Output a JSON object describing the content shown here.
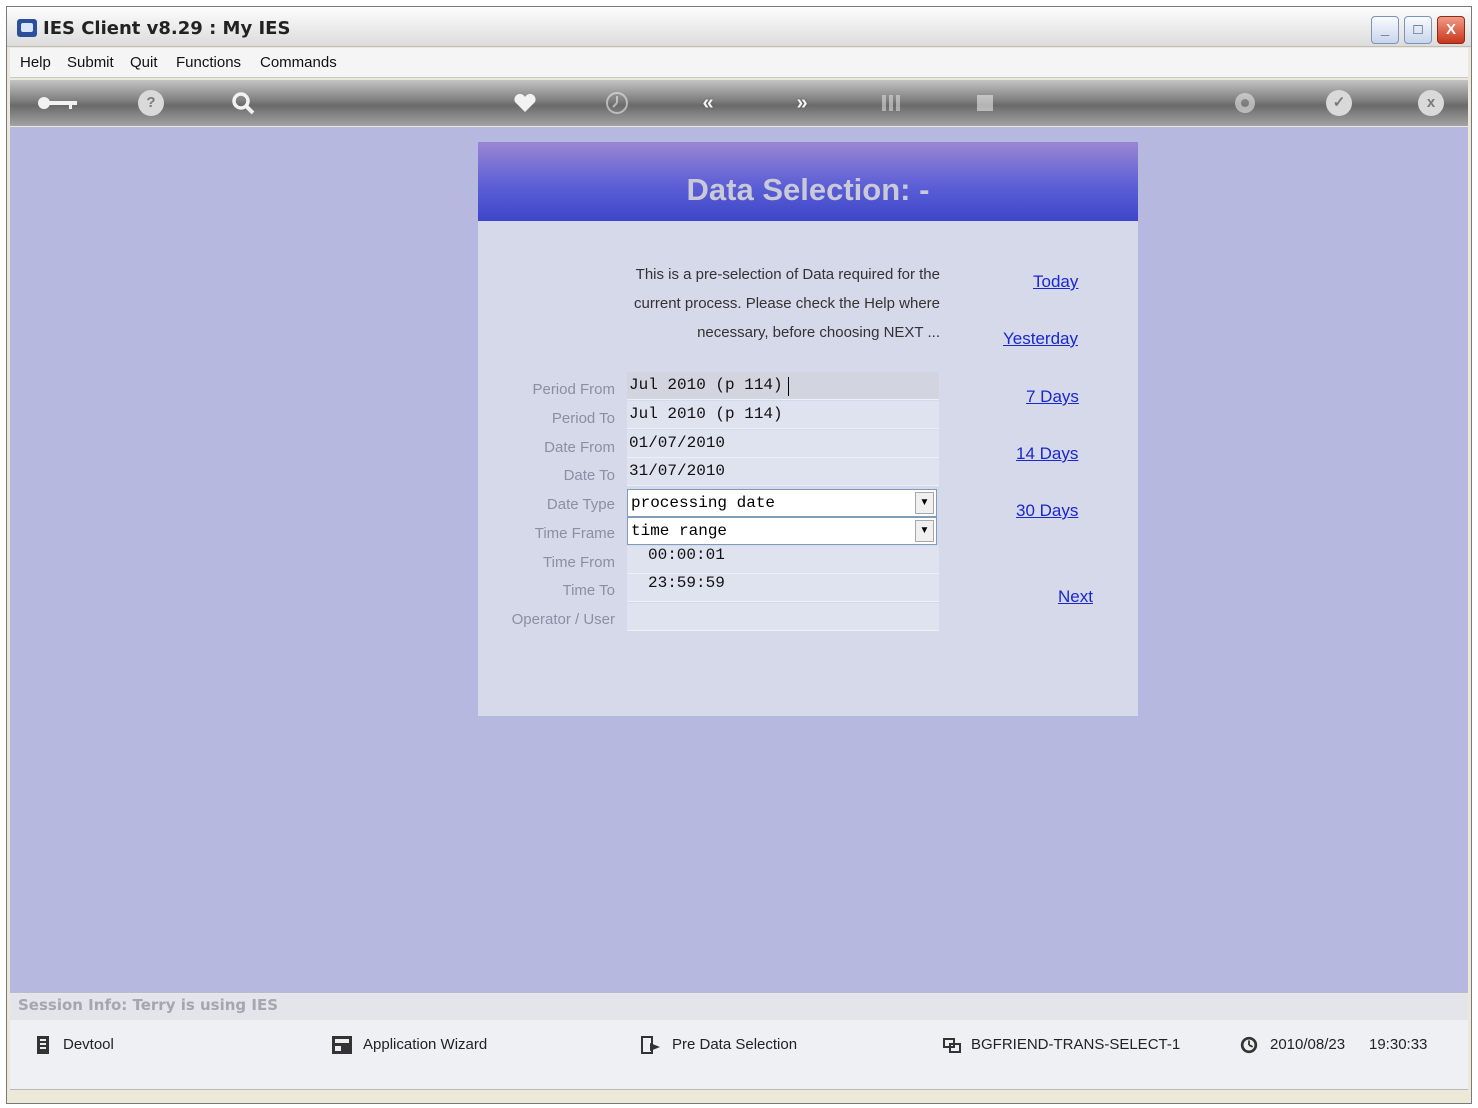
{
  "window": {
    "title": "IES Client v8.29 : My IES",
    "controls": {
      "minimize": "_",
      "maximize": "□",
      "close": "X"
    }
  },
  "menu": [
    "Help",
    "Submit",
    "Quit",
    "Functions",
    "Commands"
  ],
  "toolbar": [
    "key-icon",
    "help-icon",
    "search-icon",
    "heart-icon",
    "clock-icon",
    "rewind-icon",
    "fast-forward-icon",
    "columns-icon",
    "grid-icon",
    "recycle-icon",
    "check-icon",
    "close-icon"
  ],
  "panel": {
    "title": "Data Selection: -",
    "intro": [
      "This is a pre-selection of Data required for the",
      "current process. Please check the Help where",
      "necessary, before choosing NEXT ..."
    ],
    "fields": {
      "period_from": {
        "label": "Period From",
        "value": "Jul 2010 (p 114)"
      },
      "period_to": {
        "label": "Period To",
        "value": "Jul 2010 (p 114)"
      },
      "date_from": {
        "label": "Date From",
        "value": "01/07/2010"
      },
      "date_to": {
        "label": "Date To",
        "value": "31/07/2010"
      },
      "date_type": {
        "label": "Date Type",
        "value": "processing date"
      },
      "time_frame": {
        "label": "Time Frame",
        "value": "time range"
      },
      "time_from": {
        "label": "Time From",
        "value": "00:00:01"
      },
      "time_to": {
        "label": "Time To",
        "value": "23:59:59"
      },
      "operator": {
        "label": "Operator / User",
        "value": ""
      }
    },
    "links": {
      "today": "Today",
      "yesterday": "Yesterday",
      "days7": "7 Days",
      "days14": "14 Days",
      "days30": "30 Days",
      "next": "Next"
    }
  },
  "session": {
    "info": "Session Info: Terry is using IES"
  },
  "status": {
    "devtool": "Devtool",
    "wizard": "Application Wizard",
    "screen": "Pre Data Selection",
    "program": "BGFRIEND-TRANS-SELECT-1",
    "date": "2010/08/23",
    "time": "19:30:33"
  }
}
